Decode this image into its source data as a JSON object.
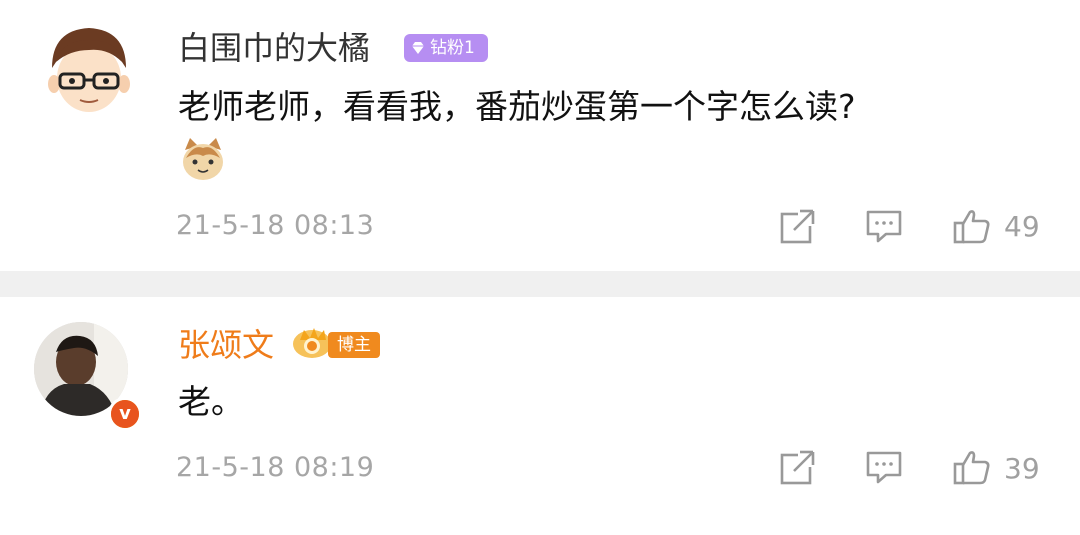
{
  "comments": [
    {
      "username": "白围巾的大橘",
      "badge_label": "钻粉1",
      "text": "老师老师，看看我，番茄炒蛋第一个字怎么读?",
      "timestamp": "21-5-18 08:13",
      "likes": "49"
    },
    {
      "username": "张颂文",
      "badge_label": "博主",
      "verified_label": "v",
      "text": "老。",
      "timestamp": "21-5-18 08:19",
      "likes": "39"
    }
  ],
  "colors": {
    "author_name": "#ef7c1a",
    "fan_badge": "#b68ef2",
    "meta_text": "#a6a6a6",
    "separator": "#f0f0f0"
  }
}
